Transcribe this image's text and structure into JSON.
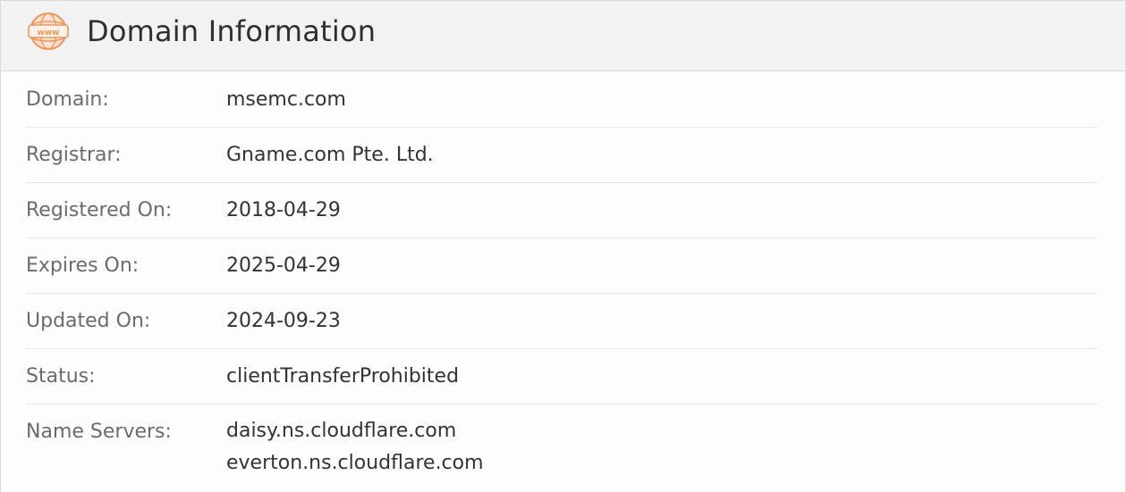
{
  "header": {
    "title": "Domain Information",
    "icon": "www-globe-icon",
    "icon_text": "www",
    "accent_color": "#f0955a"
  },
  "rows": [
    {
      "label": "Domain:",
      "value": "msemc.com"
    },
    {
      "label": "Registrar:",
      "value": "Gname.com Pte. Ltd."
    },
    {
      "label": "Registered On:",
      "value": "2018-04-29"
    },
    {
      "label": "Expires On:",
      "value": "2025-04-29"
    },
    {
      "label": "Updated On:",
      "value": "2024-09-23"
    },
    {
      "label": "Status:",
      "value": "clientTransferProhibited"
    }
  ],
  "name_servers": {
    "label": "Name Servers:",
    "values": [
      "daisy.ns.cloudflare.com",
      "everton.ns.cloudflare.com"
    ]
  }
}
